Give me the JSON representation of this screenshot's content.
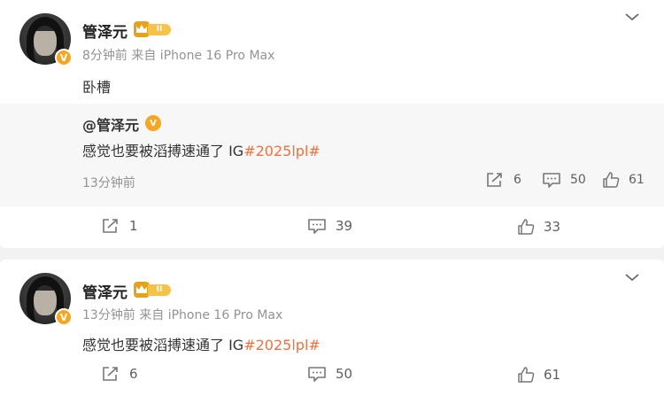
{
  "post1": {
    "username": "管泽元",
    "level": "II",
    "verified_mark": "V",
    "meta": "8分钟前 来自 iPhone 16 Pro Max",
    "text": "卧槽",
    "quoted": {
      "user": "@管泽元",
      "verified_mark": "V",
      "text_prefix": "感觉也要被滔搏速通了 IG",
      "topic": "#2025lpl#",
      "time": "13分钟前",
      "repost_count": "6",
      "comment_count": "50",
      "like_count": "61"
    },
    "repost_count": "1",
    "comment_count": "39",
    "like_count": "33"
  },
  "post2": {
    "username": "管泽元",
    "level": "II",
    "verified_mark": "V",
    "meta": "13分钟前 来自 iPhone 16 Pro Max",
    "text_prefix": "感觉也要被滔搏速通了 IG",
    "topic": "#2025lpl#",
    "repost_count": "6",
    "comment_count": "50",
    "like_count": "61"
  },
  "colors": {
    "topic": "#eb7340",
    "verified_badge": "#f5a623",
    "level_badge": "#f7c24a",
    "quote_bg": "#f7f7f7"
  },
  "icons": [
    "chevron-down-icon",
    "repost-icon",
    "comment-icon",
    "like-icon",
    "crown-icon",
    "verified-icon"
  ]
}
